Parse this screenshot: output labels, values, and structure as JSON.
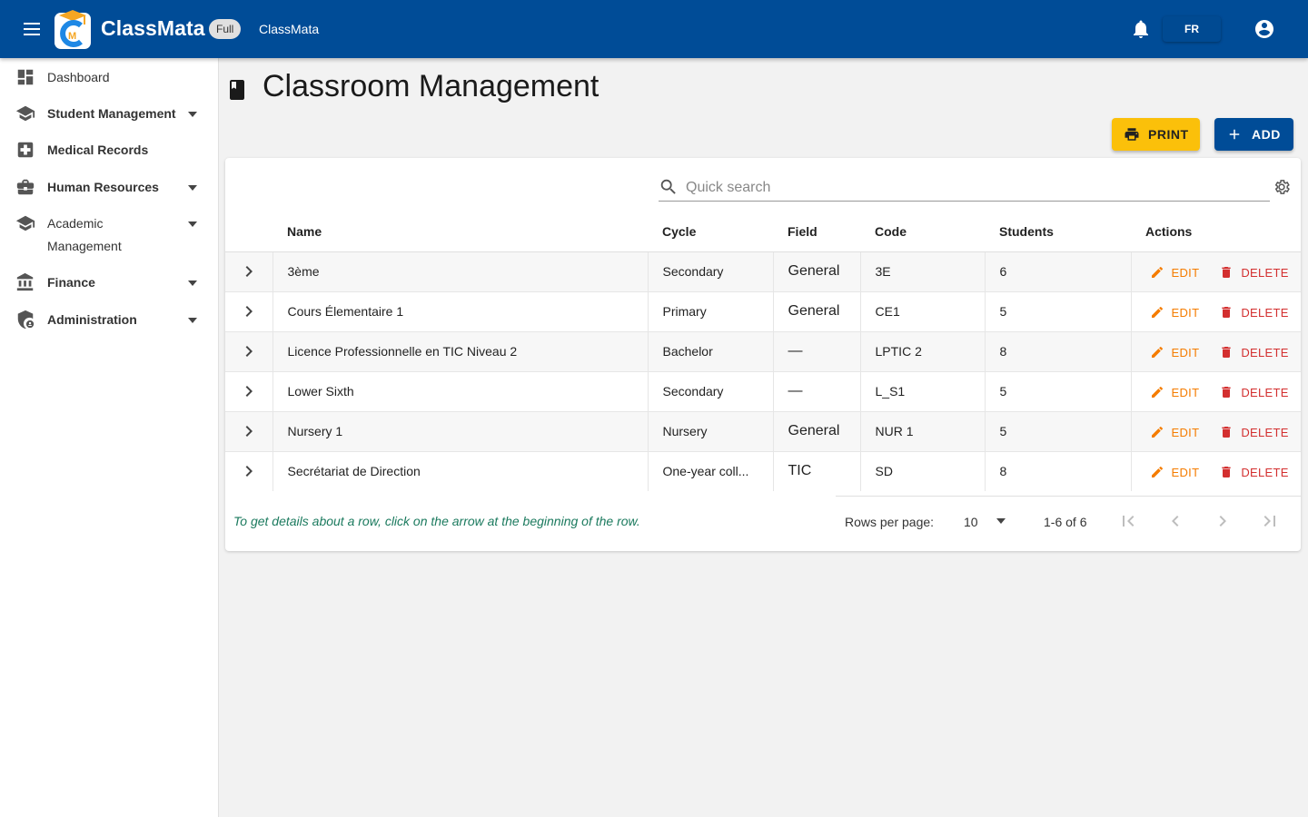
{
  "app": {
    "brand": "ClassMata",
    "plan_badge": "Full",
    "app_name": "ClassMata",
    "language": "FR",
    "brand_color": "#004c97"
  },
  "sidebar": {
    "items": [
      {
        "label": "Dashboard",
        "icon": "dashboard-icon",
        "expandable": false,
        "bold": false
      },
      {
        "label": "Student Management",
        "icon": "school-icon",
        "expandable": true,
        "bold": true
      },
      {
        "label": "Medical Records",
        "icon": "medical-cross-icon",
        "expandable": false,
        "bold": true
      },
      {
        "label": "Human Resources",
        "icon": "briefcase-icon",
        "expandable": true,
        "bold": true
      },
      {
        "label": "Academic",
        "label2": "Management",
        "icon": "school-icon",
        "expandable": true,
        "bold": false
      },
      {
        "label": "Finance",
        "icon": "bank-icon",
        "expandable": true,
        "bold": true
      },
      {
        "label": "Administration",
        "icon": "admin-shield-icon",
        "expandable": true,
        "bold": true
      }
    ]
  },
  "page": {
    "title": "Classroom Management",
    "print_label": "PRINT",
    "add_label": "ADD"
  },
  "search": {
    "placeholder": "Quick search"
  },
  "table": {
    "columns": [
      "Name",
      "Cycle",
      "Field",
      "Code",
      "Students",
      "Actions"
    ],
    "rows": [
      {
        "name": "3ème",
        "cycle": "Secondary",
        "field": "General",
        "code": "3E",
        "students": "6"
      },
      {
        "name": "Cours Élementaire 1",
        "cycle": "Primary",
        "field": "General",
        "code": "CE1",
        "students": "5"
      },
      {
        "name": "Licence Professionnelle en TIC Niveau 2",
        "cycle": "Bachelor",
        "field": "—",
        "code": "LPTIC 2",
        "students": "8"
      },
      {
        "name": "Lower Sixth",
        "cycle": "Secondary",
        "field": "—",
        "code": "L_S1",
        "students": "5"
      },
      {
        "name": "Nursery 1",
        "cycle": "Nursery",
        "field": "General",
        "code": "NUR 1",
        "students": "5"
      },
      {
        "name": "Secrétariat de Direction",
        "cycle": "One-year coll...",
        "field": "TIC",
        "code": "SD",
        "students": "8"
      }
    ],
    "edit_label": "EDIT",
    "delete_label": "DELETE",
    "edit_color": "#f57c00",
    "delete_color": "#d32f2f"
  },
  "footer": {
    "hint": "To get details about a row, click on the arrow at the beginning of the row.",
    "rows_per_page_label": "Rows per page:",
    "rows_per_page_value": "10",
    "range": "1-6 of 6"
  }
}
